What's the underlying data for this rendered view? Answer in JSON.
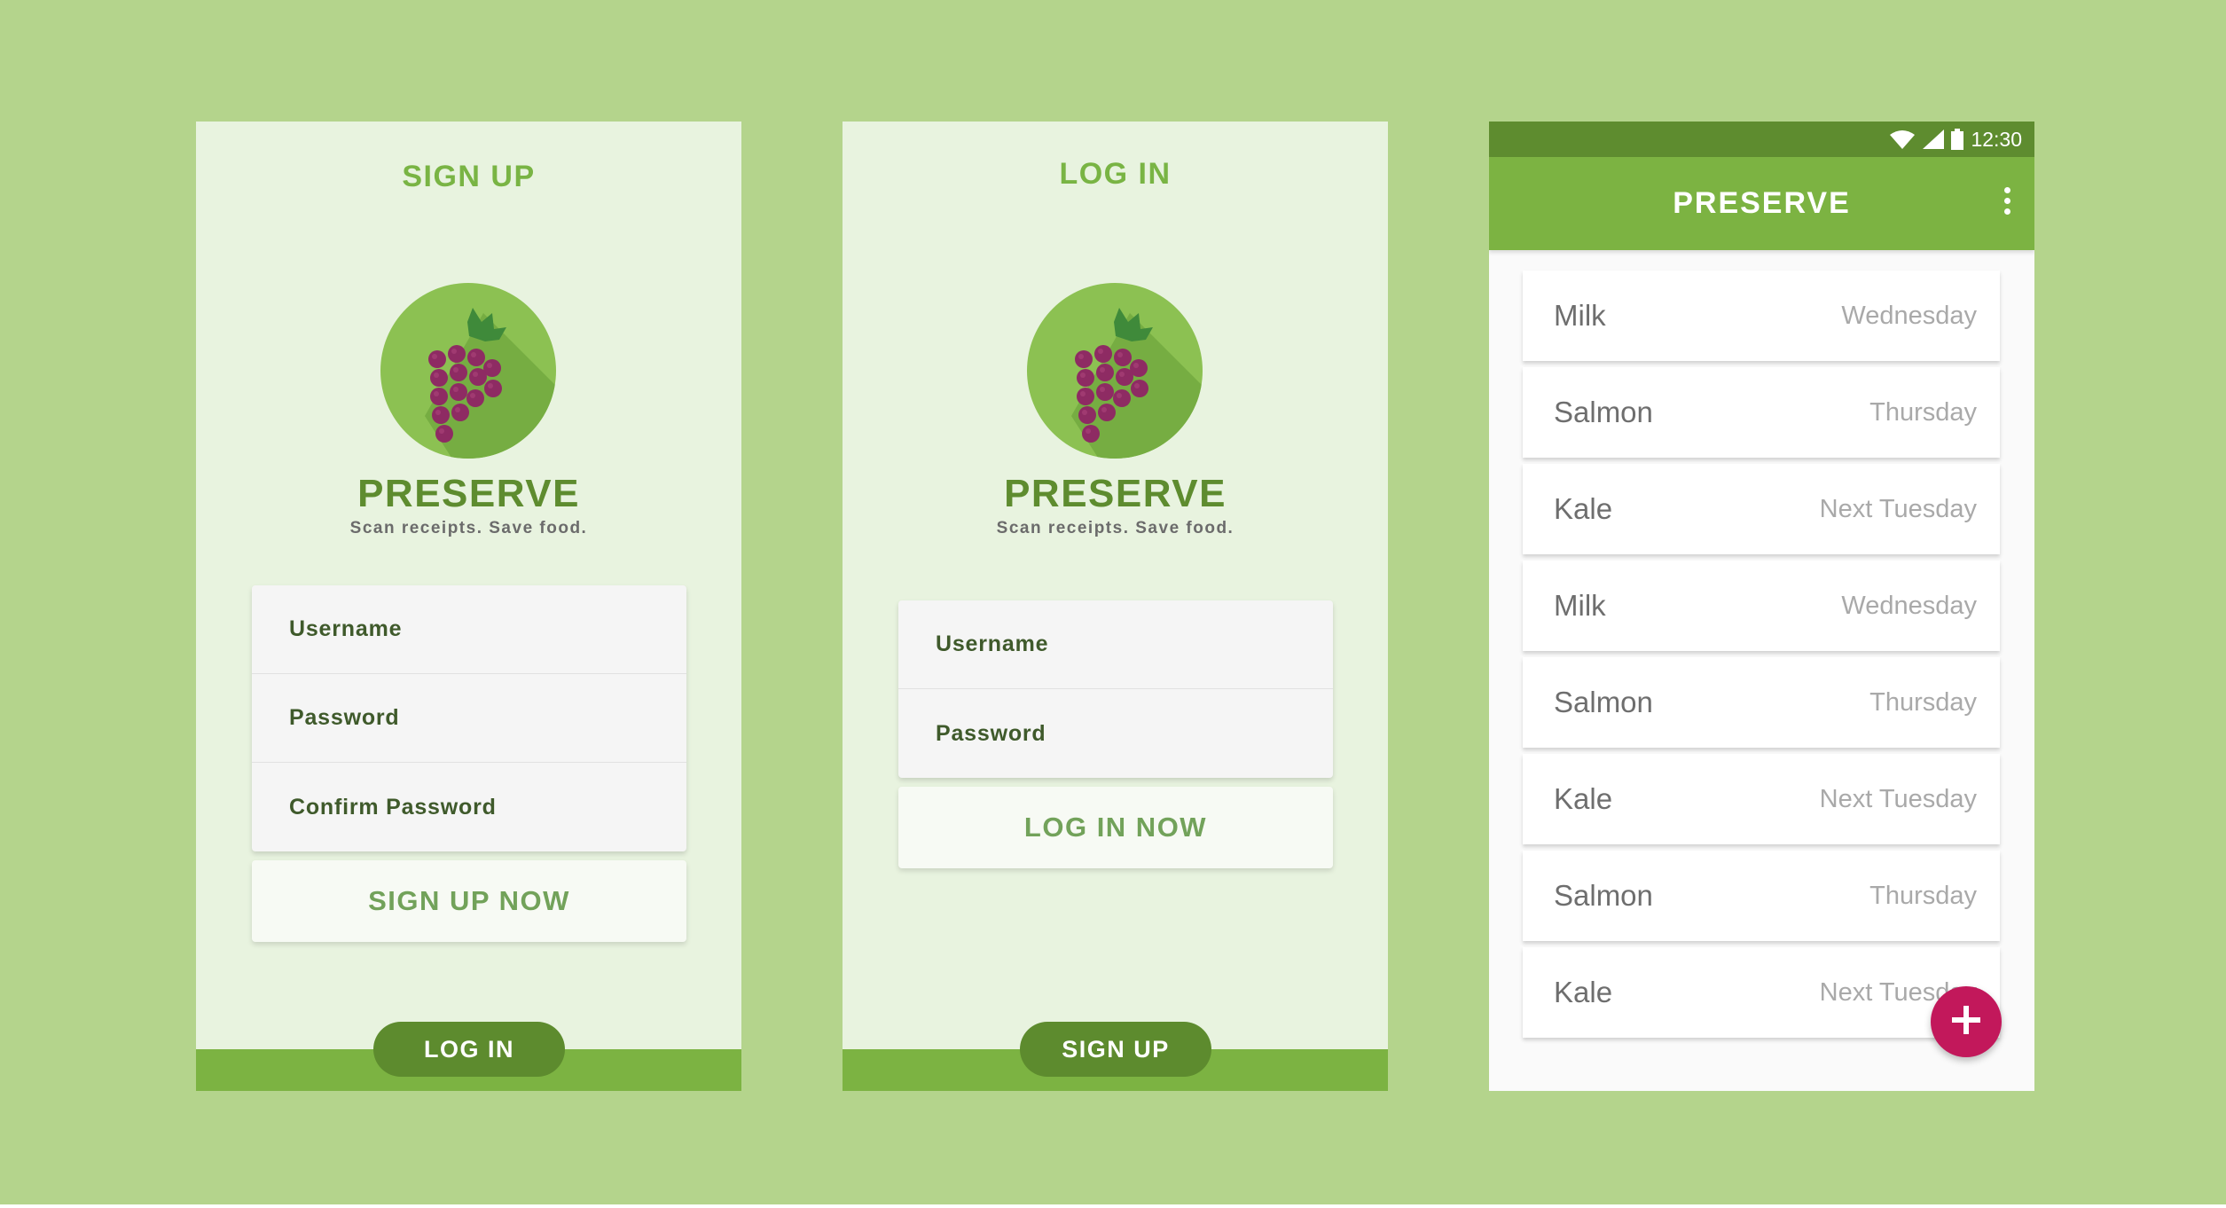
{
  "signup_screen": {
    "title": "SIGN UP",
    "brand": "PRESERVE",
    "tagline": "Scan receipts. Save food.",
    "fields": [
      "Username",
      "Password",
      "Confirm Password"
    ],
    "submit_label": "SIGN UP NOW",
    "switch_label": "LOG IN"
  },
  "login_screen": {
    "title": "LOG IN",
    "brand": "PRESERVE",
    "tagline": "Scan receipts. Save food.",
    "fields": [
      "Username",
      "Password"
    ],
    "submit_label": "LOG IN NOW",
    "switch_label": "SIGN UP"
  },
  "app_screen": {
    "status_time": "12:30",
    "title": "PRESERVE",
    "items": [
      {
        "name": "Milk",
        "day": "Wednesday"
      },
      {
        "name": "Salmon",
        "day": "Thursday"
      },
      {
        "name": "Kale",
        "day": "Next Tuesday"
      },
      {
        "name": "Milk",
        "day": "Wednesday"
      },
      {
        "name": "Salmon",
        "day": "Thursday"
      },
      {
        "name": "Kale",
        "day": "Next Tuesday"
      },
      {
        "name": "Salmon",
        "day": "Thursday"
      },
      {
        "name": "Kale",
        "day": "Next Tuesday"
      }
    ]
  },
  "colors": {
    "background": "#b4d48c",
    "primary_green": "#7cb342",
    "dark_green": "#5e8c2f",
    "grape_purple": "#8e2b63",
    "fab_pink": "#c2185b"
  },
  "icons": [
    "grape-logo-icon",
    "wifi-icon",
    "signal-icon",
    "battery-icon",
    "more-vert-icon",
    "plus-icon"
  ]
}
